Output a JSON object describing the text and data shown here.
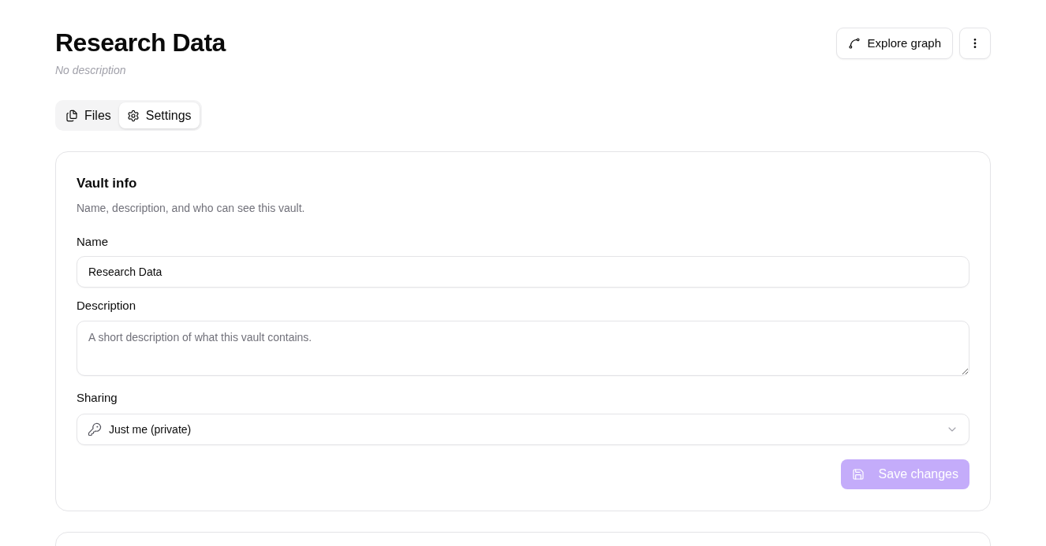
{
  "header": {
    "title": "Research Data",
    "description": "No description",
    "explore_button": {
      "label": "Explore graph"
    }
  },
  "tabs": [
    {
      "label": "Files",
      "selected": false
    },
    {
      "label": "Settings",
      "selected": true
    }
  ],
  "vault_info": {
    "title": "Vault info",
    "subtitle": "Name, description, and who can see this vault.",
    "fields": [
      {
        "kind": "text",
        "label": "Name",
        "value": "Research Data"
      },
      {
        "kind": "textarea",
        "label": "Description",
        "placeholder": "A short description of what this vault contains."
      },
      {
        "kind": "select",
        "label": "Sharing",
        "value": "Just me (private)"
      }
    ],
    "save_button": {
      "label": "Save changes",
      "disabled": true
    }
  }
}
